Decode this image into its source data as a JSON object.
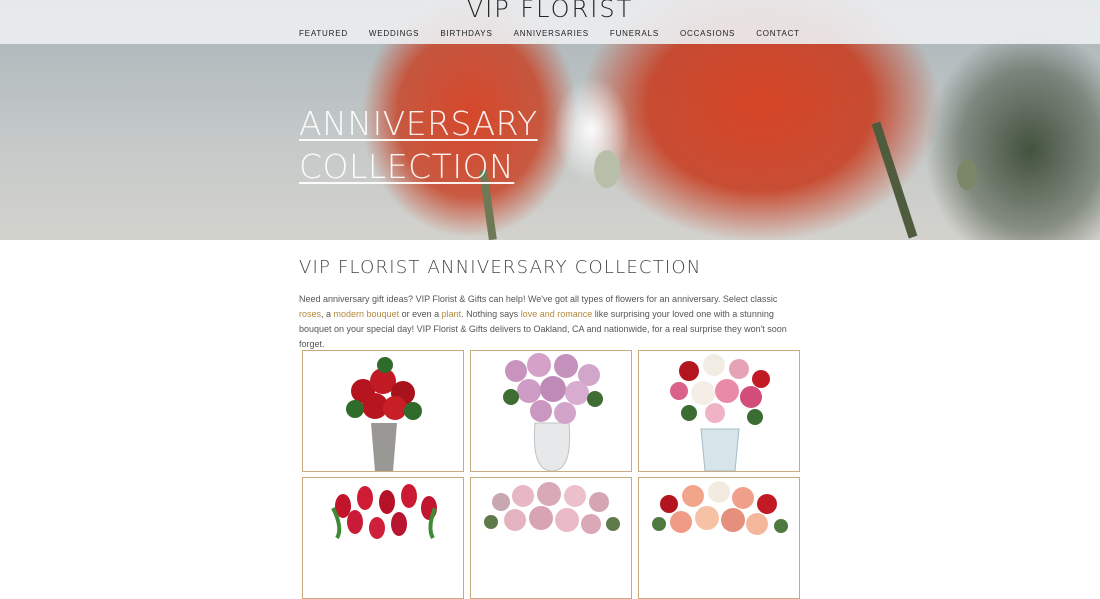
{
  "site": {
    "logo": "VIP FLORIST"
  },
  "nav": {
    "items": [
      "FEATURED",
      "WEDDINGS",
      "BIRTHDAYS",
      "ANNIVERSARIES",
      "FUNERALS",
      "OCCASIONS",
      "CONTACT"
    ]
  },
  "hero": {
    "line1": "ANNIVERSARY",
    "line2": "COLLECTION"
  },
  "section": {
    "title": "VIP FLORIST ANNIVERSARY COLLECTION"
  },
  "intro": {
    "t1": "Need anniversary gift ideas? VIP Florist & Gifts can help! We've got all types of flowers for an anniversary. Select classic ",
    "link_roses": "roses",
    "t2": ", a ",
    "link_modern": "modern bouquet",
    "t3": " or even a ",
    "link_plant": "plant",
    "t4": ". Nothing says ",
    "link_love": "love and romance",
    "t5": " like surprising your loved one with a stunning bouquet on your special day! VIP Florist & Gifts delivers to Oakland, CA and nationwide, for a real surprise they won't soon forget."
  },
  "colors": {
    "accent": "#b38a3c",
    "card_border": "#c7ab7f",
    "header_bg": "#eceef0"
  },
  "products": [
    {
      "icon": "red-roses-bouquet-icon"
    },
    {
      "icon": "lavender-roses-bouquet-icon"
    },
    {
      "icon": "pink-lilies-bouquet-icon"
    },
    {
      "icon": "red-tulips-bouquet-icon"
    },
    {
      "icon": "pink-roses-bouquet-icon"
    },
    {
      "icon": "mixed-roses-bouquet-icon"
    }
  ]
}
